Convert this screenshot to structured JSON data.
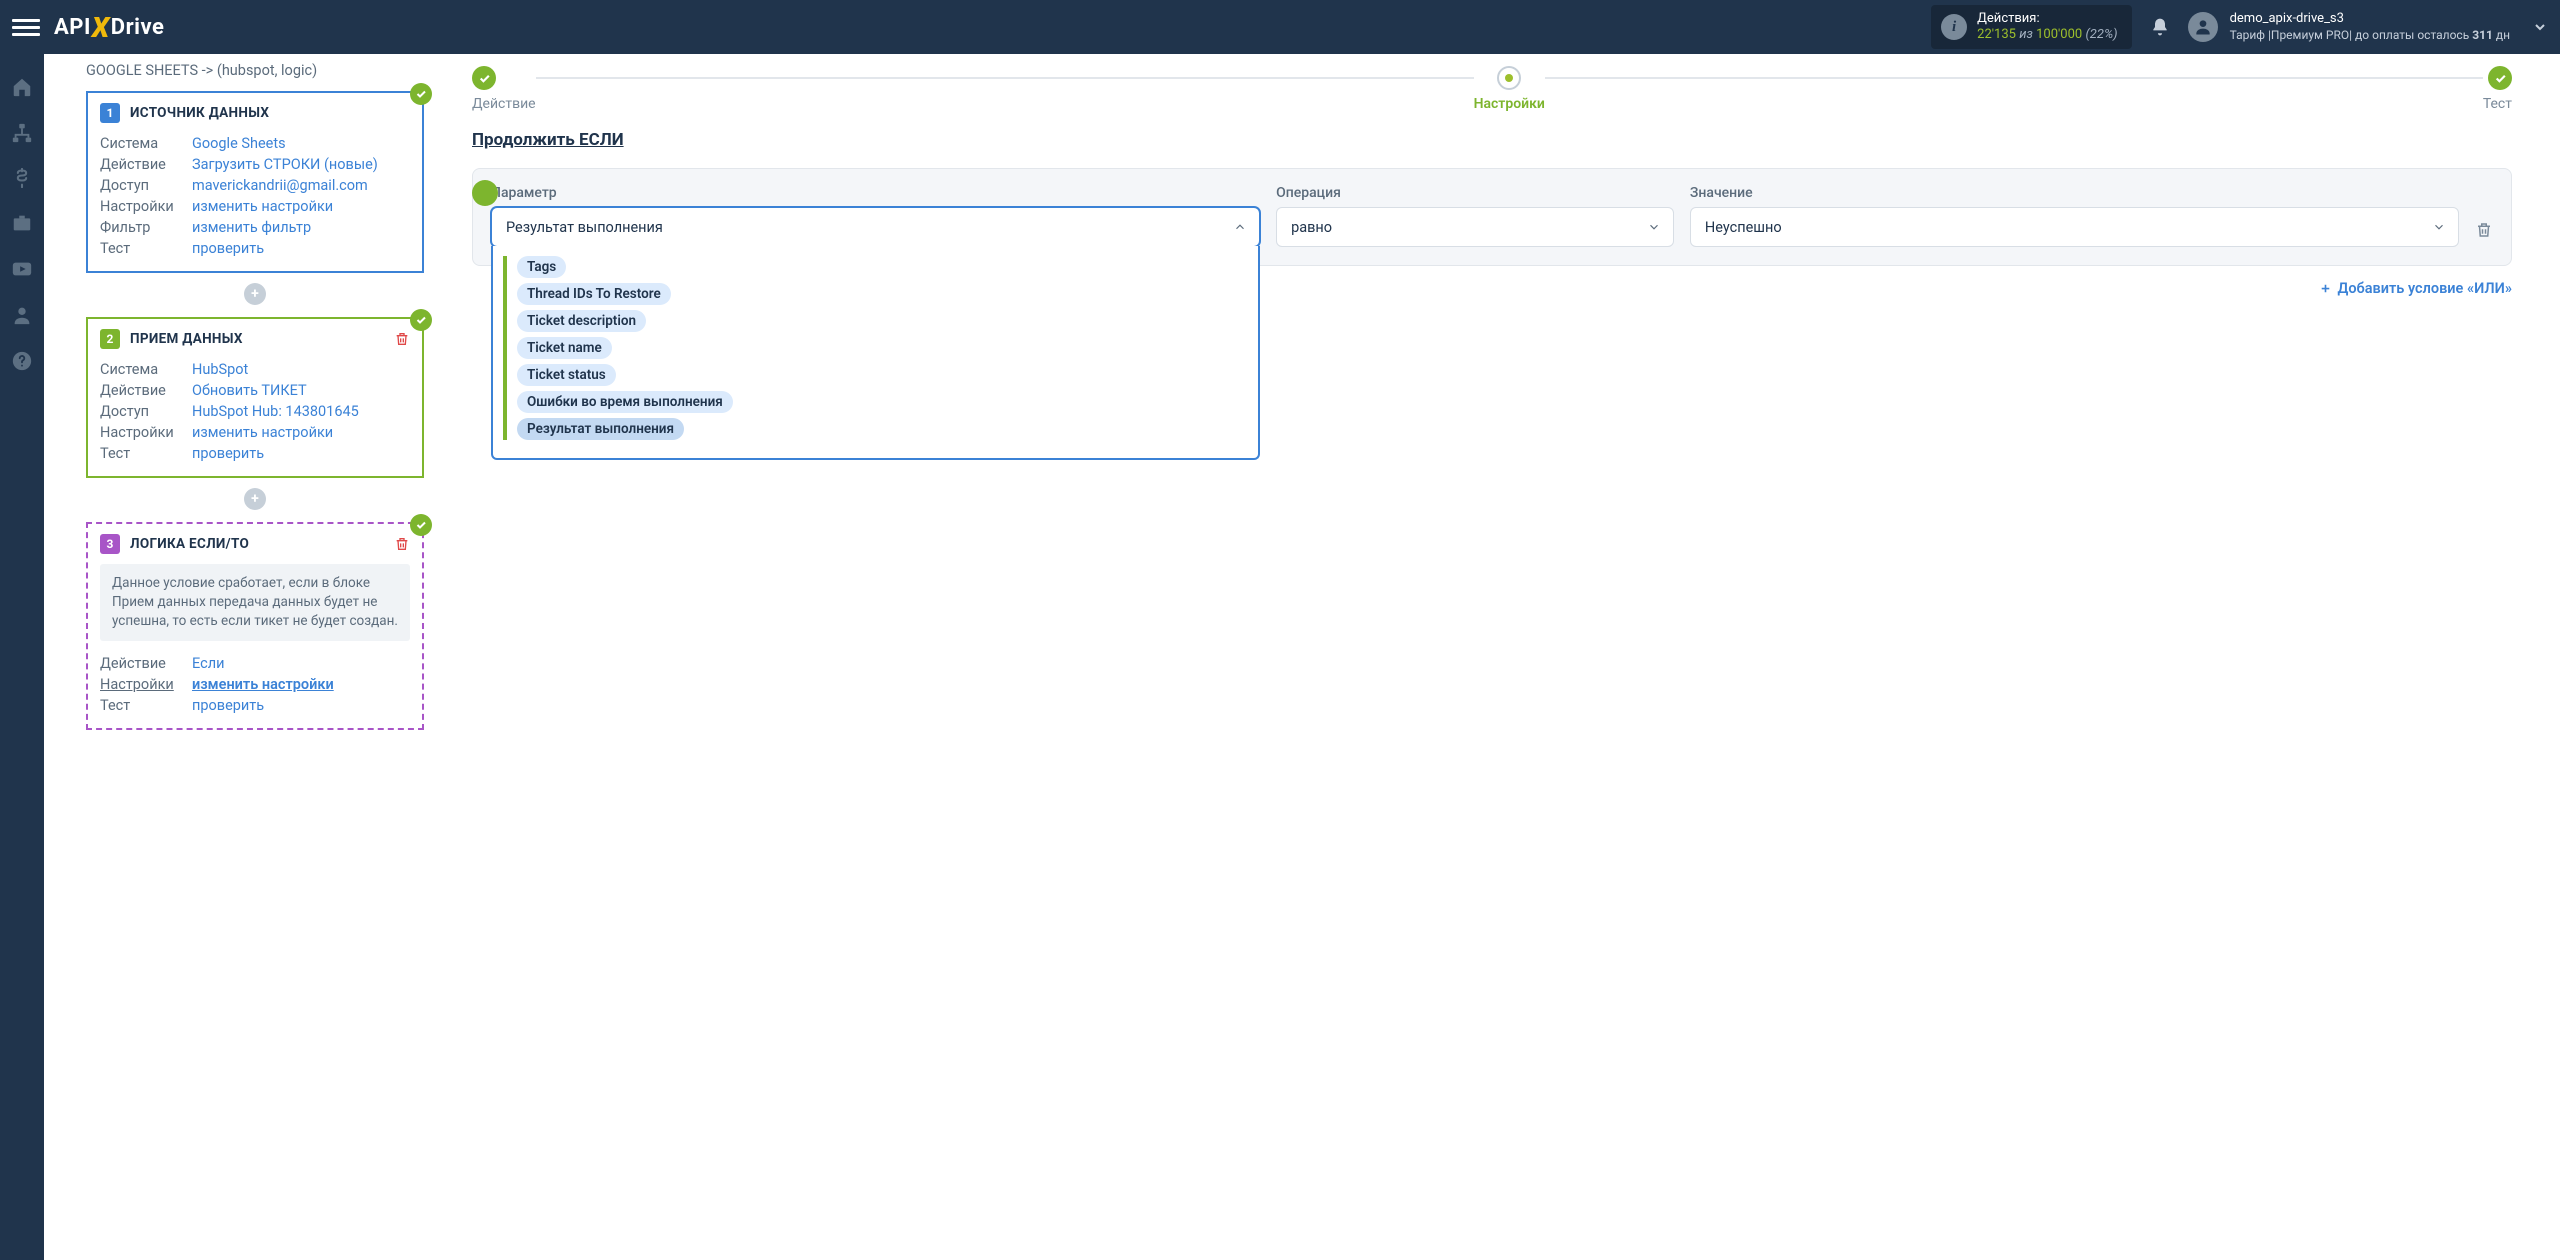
{
  "topnav": {
    "logo_1": "API",
    "logo_x": "X",
    "logo_2": "Drive",
    "actions_label": "Действия:",
    "actions_used": "22'135",
    "actions_slash": "из",
    "actions_total": "100'000",
    "actions_pct": "(22%)",
    "username": "demo_apix-drive_s3",
    "tariff": "Тариф |Премиум PRO|  до оплаты осталось ",
    "days": "311",
    "days_suffix": " дн"
  },
  "leftcol": {
    "connection_title": "GOOGLE SHEETS -> (hubspot, logic)",
    "card1": {
      "num": "1",
      "title": "ИСТОЧНИК ДАННЫХ",
      "rows": [
        {
          "lbl": "Система",
          "val": "Google Sheets"
        },
        {
          "lbl": "Действие",
          "val": "Загрузить СТРОКИ (новые)"
        },
        {
          "lbl": "Доступ",
          "val": "maverickandrii@gmail.com"
        },
        {
          "lbl": "Настройки",
          "val": "изменить настройки"
        },
        {
          "lbl": "Фильтр",
          "val": "изменить фильтр"
        },
        {
          "lbl": "Тест",
          "val": "проверить"
        }
      ]
    },
    "card2": {
      "num": "2",
      "title": "ПРИЕМ ДАННЫХ",
      "rows": [
        {
          "lbl": "Система",
          "val": "HubSpot"
        },
        {
          "lbl": "Действие",
          "val": "Обновить ТИКЕТ"
        },
        {
          "lbl": "Доступ",
          "val": "HubSpot Hub: 143801645"
        },
        {
          "lbl": "Настройки",
          "val": "изменить настройки"
        },
        {
          "lbl": "Тест",
          "val": "проверить"
        }
      ]
    },
    "card3": {
      "num": "3",
      "title": "ЛОГИКА ЕСЛИ/ТО",
      "note": "Данное условие сработает, если в блоке Прием данных передача данных будет не успешна, то есть если тикет не будет создан.",
      "rows": [
        {
          "lbl": "Действие",
          "val": "Если"
        },
        {
          "lbl": "Настройки",
          "val": "изменить настройки",
          "u": true
        },
        {
          "lbl": "Тест",
          "val": "проверить"
        }
      ]
    }
  },
  "stepper": {
    "s1": "Действие",
    "s2": "Настройки",
    "s3": "Тест"
  },
  "section_title": "Продолжить ЕСЛИ",
  "cond": {
    "param_lbl": "Параметр",
    "op_lbl": "Операция",
    "val_lbl": "Значение",
    "param_sel": "Результат выполнения",
    "op_sel": "равно",
    "val_sel": "Неуспешно",
    "options": [
      "Tags",
      "Thread IDs To Restore",
      "Ticket description",
      "Ticket name",
      "Ticket status",
      "Ошибки во время выполнения",
      "Результат выполнения"
    ]
  },
  "add_or": "Добавить условие «ИЛИ»"
}
